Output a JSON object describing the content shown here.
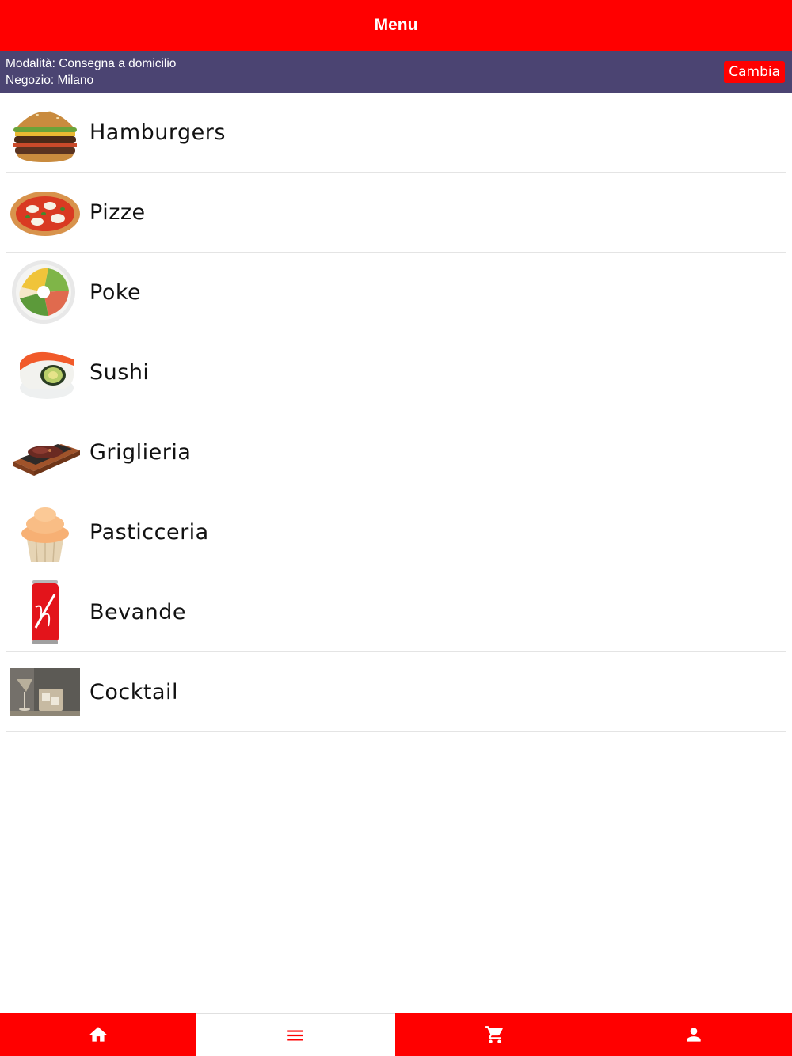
{
  "header": {
    "title": "Menu"
  },
  "info": {
    "mode_label": "Modalità:",
    "mode_value": "Consegna a domicilio",
    "store_label": "Negozio:",
    "store_value": "Milano",
    "change_button": "Cambia"
  },
  "categories": [
    {
      "label": "Hamburgers",
      "icon": "hamburger-image"
    },
    {
      "label": "Pizze",
      "icon": "pizza-image"
    },
    {
      "label": "Poke",
      "icon": "poke-bowl-image"
    },
    {
      "label": "Sushi",
      "icon": "sushi-image"
    },
    {
      "label": "Griglieria",
      "icon": "grilled-meat-image"
    },
    {
      "label": "Pasticceria",
      "icon": "cupcake-image"
    },
    {
      "label": "Bevande",
      "icon": "soda-can-image"
    },
    {
      "label": "Cocktail",
      "icon": "cocktail-image"
    }
  ],
  "tabs": [
    {
      "name": "home",
      "icon": "home-icon",
      "active": false
    },
    {
      "name": "menu",
      "icon": "menu-icon",
      "active": true
    },
    {
      "name": "cart",
      "icon": "cart-icon",
      "active": false
    },
    {
      "name": "account",
      "icon": "person-icon",
      "active": false
    }
  ],
  "colors": {
    "primary": "#ff0000",
    "info_bar": "#4b4472",
    "background": "#ffffff"
  }
}
